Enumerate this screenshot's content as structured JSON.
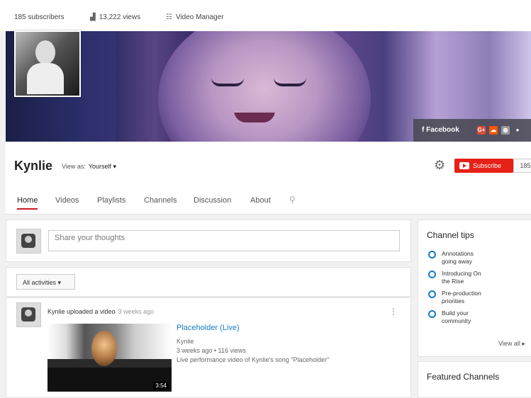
{
  "stats": {
    "subscribers": "185 subscribers",
    "views": "13,222 views",
    "video_manager": "Video Manager"
  },
  "social": {
    "facebook": "Facebook"
  },
  "channel": {
    "name": "Kynlie",
    "view_as_label": "View as:",
    "view_as_value": "Yourself ▾",
    "subscribe_label": "Subscribe",
    "subscribe_count": "185"
  },
  "tabs": [
    "Home",
    "Videos",
    "Playlists",
    "Channels",
    "Discussion",
    "About"
  ],
  "composer": {
    "placeholder": "Share your thoughts"
  },
  "filter": {
    "label": "All activities ▾"
  },
  "activity": {
    "author_line": "Kynlie uploaded a video",
    "time": "3 weeks ago",
    "video": {
      "title": "Placeholder (Live)",
      "channel": "Kynlie",
      "meta": "3 weeks ago • 116 views",
      "description": "Live performance video of Kynlie's song \"Placeholder\"",
      "duration": "3:54"
    }
  },
  "channel_tips": {
    "title": "Channel tips",
    "items": [
      {
        "line1": "Annotations",
        "line2": "going away"
      },
      {
        "line1": "Introducing On",
        "line2": "the Rise"
      },
      {
        "line1": "Pre-production",
        "line2": "priorities"
      },
      {
        "line1": "Build your",
        "line2": "community"
      }
    ],
    "view_all": "View all ▸"
  },
  "featured": {
    "title": "Featured Channels"
  },
  "colors": {
    "accent": "#cc181e",
    "subscribe": "#e62117",
    "link": "#167ac6"
  }
}
